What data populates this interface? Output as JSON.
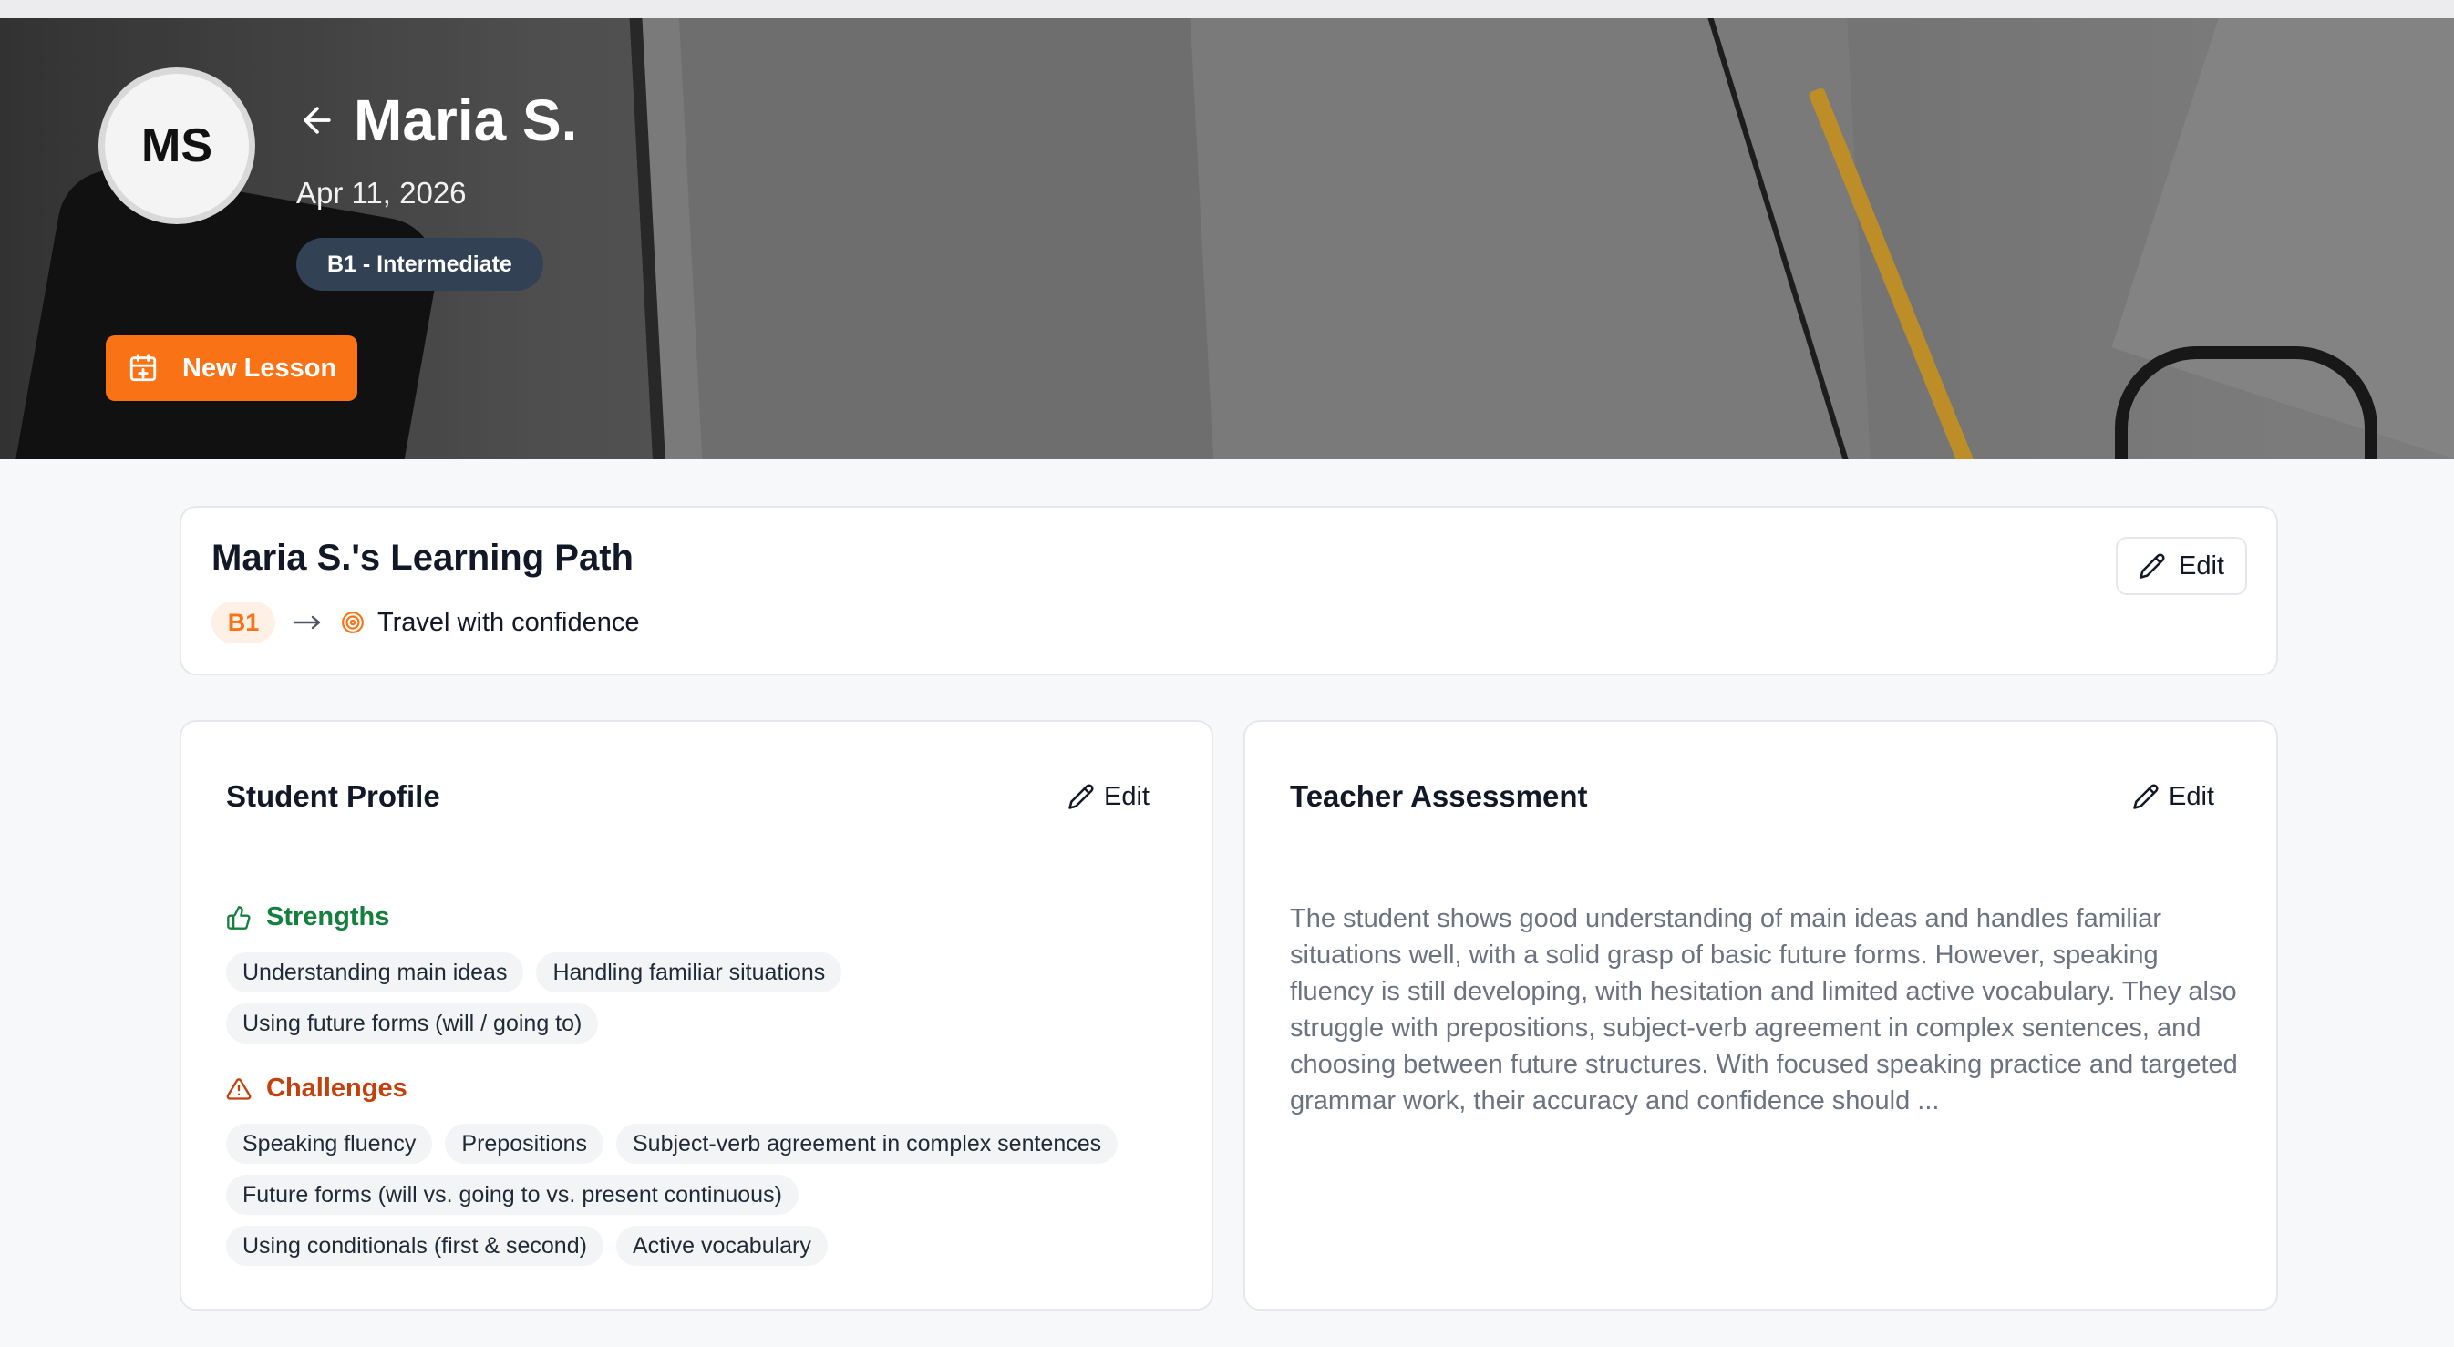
{
  "header": {
    "avatar_initials": "MS",
    "student_name": "Maria S.",
    "date": "Apr 11, 2026",
    "level_badge": "B1 - Intermediate",
    "new_lesson_label": "New Lesson",
    "accent_color": "#f97316"
  },
  "learning_path": {
    "title": "Maria S.'s Learning Path",
    "current_level": "B1",
    "goal": "Travel with confidence",
    "edit_label": "Edit"
  },
  "student_profile": {
    "title": "Student Profile",
    "edit_label": "Edit",
    "strengths_label": "Strengths",
    "strengths": [
      "Understanding main ideas",
      "Handling familiar situations",
      "Using future forms (will / going to)"
    ],
    "challenges_label": "Challenges",
    "challenges": [
      "Speaking fluency",
      "Prepositions",
      "Subject-verb agreement in complex sentences",
      "Future forms (will vs. going to vs. present continuous)",
      "Using conditionals (first & second)",
      "Active vocabulary"
    ]
  },
  "teacher_assessment": {
    "title": "Teacher Assessment",
    "edit_label": "Edit",
    "text": "The student shows good understanding of main ideas and handles familiar situations well, with a solid grasp of basic future forms. However, speaking fluency is still developing, with hesitation and limited active vocabulary. They also struggle with prepositions, subject-verb agreement in complex sentences, and choosing between future structures. With focused speaking practice and targeted grammar work, their accuracy and confidence should ..."
  },
  "icons": {
    "back": "arrow-left-icon",
    "new_lesson": "calendar-plus-icon",
    "path_arrow": "arrow-right-icon",
    "goal": "target-icon",
    "edit": "pencil-icon",
    "strengths": "thumbs-up-icon",
    "challenges": "warning-triangle-icon"
  }
}
